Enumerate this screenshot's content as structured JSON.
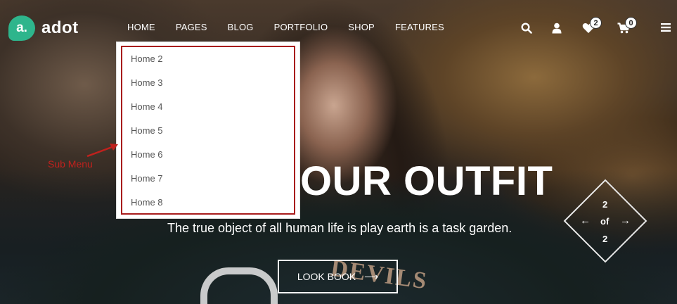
{
  "brand": {
    "mark": "a.",
    "name": "adot",
    "color": "#2eb58c"
  },
  "nav": {
    "items": [
      {
        "label": "HOME"
      },
      {
        "label": "PAGES"
      },
      {
        "label": "BLOG"
      },
      {
        "label": "PORTFOLIO"
      },
      {
        "label": "SHOP"
      },
      {
        "label": "FEATURES"
      }
    ]
  },
  "tools": {
    "search_icon": "search-icon",
    "account_icon": "user-icon",
    "wishlist_count": "2",
    "cart_count": "0",
    "menu_icon": "hamburger-icon"
  },
  "submenu": {
    "items": [
      "Home 2",
      "Home 3",
      "Home 4",
      "Home 5",
      "Home 6",
      "Home 7",
      "Home 8"
    ],
    "highlight_color": "#a81c1c"
  },
  "annotation": {
    "label": "Sub Menu",
    "color": "#c0211d"
  },
  "hero": {
    "headline": "OUR OUTFIT",
    "tagline": "The true object of all human life is play earth is a task garden.",
    "button_label": "LOOK BOOK",
    "button_arrow": "⟶"
  },
  "pager": {
    "current": "2",
    "separator": "of",
    "total": "2",
    "prev_arrow": "←",
    "next_arrow": "→"
  }
}
